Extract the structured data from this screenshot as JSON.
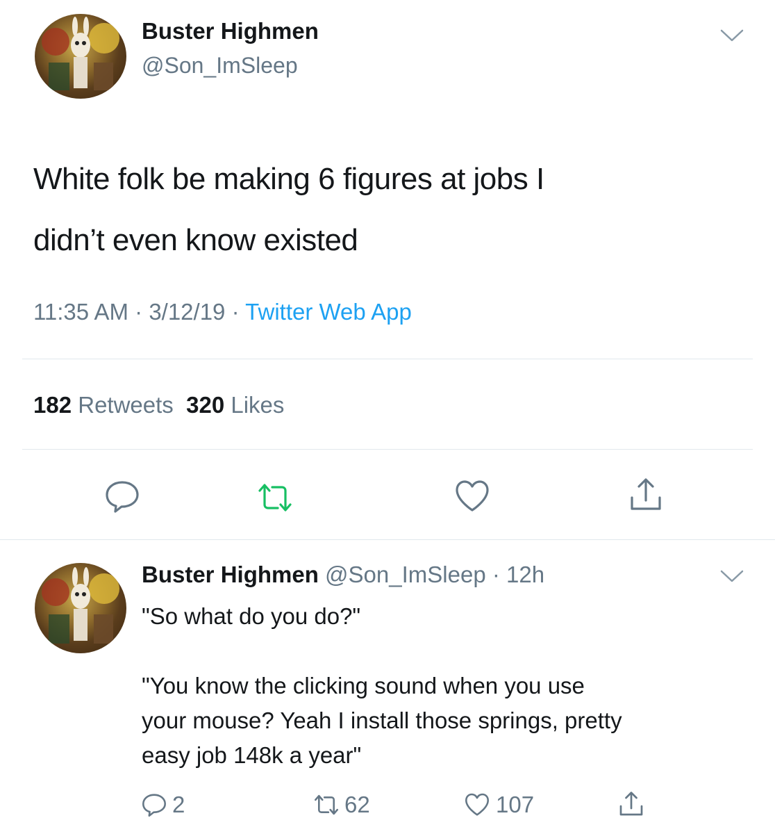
{
  "main_tweet": {
    "display_name": "Buster Highmen",
    "handle": "@Son_ImSleep",
    "text_line1": "White folk be making 6 figures at jobs I",
    "text_line2": "didn’t even know existed",
    "time": "11:35 AM",
    "date": "3/12/19",
    "source": "Twitter Web App",
    "separator": " · ",
    "retweets_count": "182",
    "retweets_label": "Retweets",
    "likes_count": "320",
    "likes_label": "Likes"
  },
  "reply_tweet": {
    "display_name": "Buster Highmen",
    "handle": "@Son_ImSleep",
    "age": "12h",
    "separator": " · ",
    "text": "\"So what do you do?\"\n\n\"You know the clicking sound when you use\nyour mouse? Yeah I install those springs, pretty\neasy job 148k a year\"",
    "reply_count": "2",
    "retweet_count": "62",
    "like_count": "107"
  },
  "colors": {
    "text_primary": "#14171a",
    "text_secondary": "#657786",
    "link": "#1da1f2",
    "retweet_green": "#17bf63",
    "divider": "#e1e8ed"
  },
  "icons": [
    "chevron-down-icon",
    "reply-icon",
    "retweet-icon",
    "like-icon",
    "share-icon"
  ]
}
